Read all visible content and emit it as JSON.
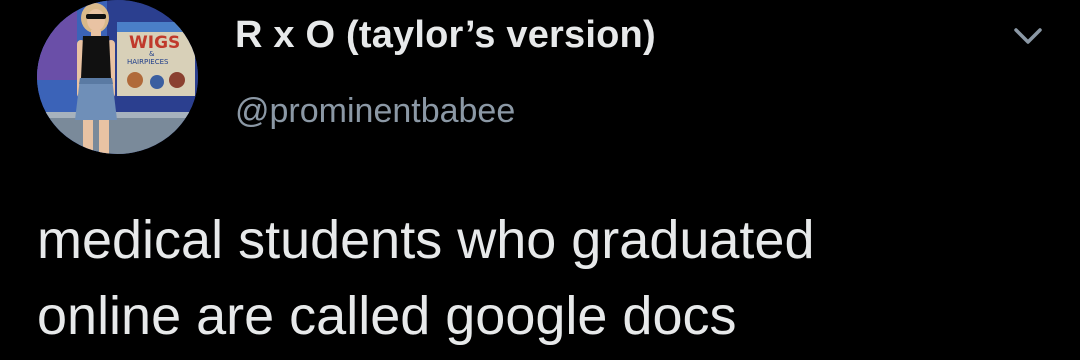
{
  "tweet": {
    "display_name": "R x O (taylor’s version)",
    "handle": "@prominentbabee",
    "text": "medical students who graduated\nonline are called google docs",
    "menu_icon": "chevron-down-icon",
    "avatar_sign_text": [
      "WIGS",
      "&",
      "HAIRPIECES"
    ]
  },
  "colors": {
    "background": "#000000",
    "primary_text": "#e7e9ea",
    "secondary_text": "#8b98a5"
  }
}
